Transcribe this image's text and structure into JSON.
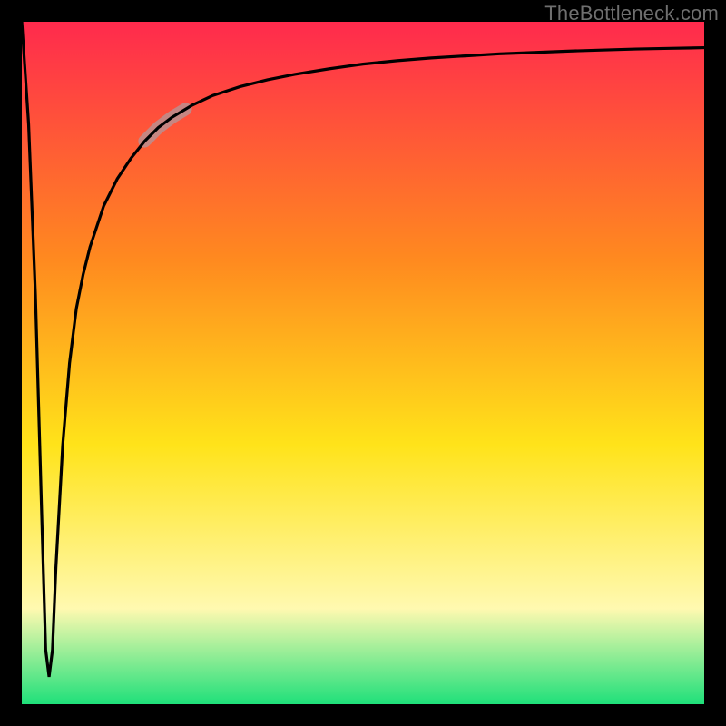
{
  "watermark": "TheBottleneck.com",
  "colors": {
    "frame": "#000000",
    "watermark_text": "#6f6f6f",
    "curve": "#000000",
    "highlight": "#bb8f8f",
    "gradient_top": "#ff2a4d",
    "gradient_mid1": "#ff8a1f",
    "gradient_mid2": "#ffe31a",
    "gradient_mid3": "#fff9b0",
    "gradient_bottom": "#1fe07a"
  },
  "chart_data": {
    "type": "line",
    "title": "",
    "xlabel": "",
    "ylabel": "",
    "xlim": [
      0,
      100
    ],
    "ylim": [
      0,
      100
    ],
    "x": [
      0,
      1,
      2,
      3,
      3.5,
      4,
      4.5,
      5,
      6,
      7,
      8,
      9,
      10,
      12,
      14,
      16,
      18,
      20,
      22,
      25,
      28,
      32,
      36,
      40,
      45,
      50,
      55,
      60,
      65,
      70,
      75,
      80,
      85,
      90,
      95,
      100
    ],
    "values": [
      100,
      85,
      60,
      25,
      8,
      4,
      8,
      20,
      38,
      50,
      58,
      63,
      67,
      73,
      77,
      80,
      82.5,
      84.5,
      86,
      87.8,
      89.2,
      90.5,
      91.5,
      92.3,
      93.1,
      93.8,
      94.3,
      94.7,
      95,
      95.3,
      95.5,
      95.7,
      95.85,
      96,
      96.1,
      96.2
    ],
    "highlight_segment": {
      "x_start": 18,
      "x_end": 24
    },
    "note": "y is plotted with 100 at top, 0 at bottom; curve drops sharply from top-left to a narrow minimum near x≈4 then rises asymptotically toward ~96."
  }
}
